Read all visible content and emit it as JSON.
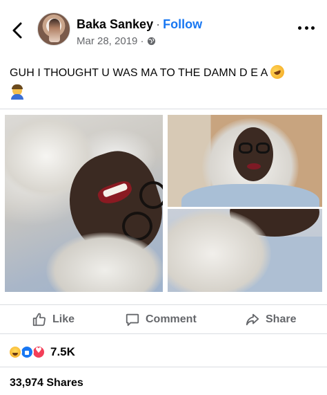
{
  "header": {
    "author_name": "Baka Sankey",
    "separator": "·",
    "follow_label": "Follow",
    "date": "Mar 28, 2019 ·",
    "privacy_icon": "globe-icon",
    "back_icon": "back-chevron-icon",
    "more_icon": "more-options-icon"
  },
  "post": {
    "text": "GUH I THOUGHT U WAS MA TO THE DAMN D E A",
    "emojis": [
      "rolling-on-floor-laughing-emoji",
      "facepalm-emoji"
    ]
  },
  "photos": [
    "photo-left",
    "photo-top-right",
    "photo-bottom-right"
  ],
  "actions": {
    "like_label": "Like",
    "comment_label": "Comment",
    "share_label": "Share"
  },
  "reactions": {
    "icons": [
      "haha",
      "like",
      "love"
    ],
    "count": "7.5K"
  },
  "shares": {
    "text": "33,974 Shares"
  },
  "colors": {
    "accent": "#1877f2",
    "secondary_text": "#65676b",
    "love": "#f33e58",
    "haha": "#f5a623"
  }
}
